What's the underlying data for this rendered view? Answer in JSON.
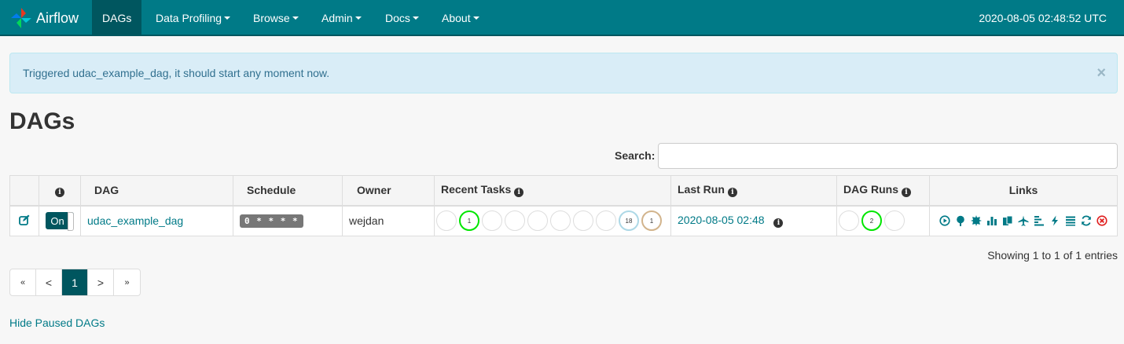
{
  "nav": {
    "brand": "Airflow",
    "items": [
      {
        "label": "DAGs"
      },
      {
        "label": "Data Profiling"
      },
      {
        "label": "Browse"
      },
      {
        "label": "Admin"
      },
      {
        "label": "Docs"
      },
      {
        "label": "About"
      }
    ],
    "clock": "2020-08-05 02:48:52 UTC"
  },
  "alert": {
    "message": "Triggered udac_example_dag, it should start any moment now.",
    "close": "×"
  },
  "page": {
    "title": "DAGs",
    "search_label": "Search:",
    "search_value": ""
  },
  "table": {
    "headers": {
      "info": "i",
      "dag": "DAG",
      "schedule": "Schedule",
      "owner": "Owner",
      "recent_tasks": "Recent Tasks",
      "last_run": "Last Run",
      "dag_runs": "DAG Runs",
      "links": "Links"
    },
    "rows": [
      {
        "toggle": "On",
        "dag": "udac_example_dag",
        "schedule": "0 * * * *",
        "owner": "wejdan",
        "recent_tasks": [
          "",
          "1",
          "",
          "",
          "",
          "",
          "",
          "",
          "18",
          "1"
        ],
        "last_run": "2020-08-05 02:48",
        "dag_runs": [
          "",
          "2",
          ""
        ]
      }
    ]
  },
  "footer": {
    "showing": "Showing 1 to 1 of 1 entries",
    "pager": [
      "«",
      "<",
      "1",
      ">",
      "»"
    ],
    "hide_paused": "Hide Paused DAGs"
  },
  "colors": {
    "brand": "#007a87",
    "brand_dark": "#00565f",
    "success": "#00e600",
    "queued": "#add8e6",
    "upstream_failed": "#d2b48c",
    "danger": "#e02020"
  }
}
